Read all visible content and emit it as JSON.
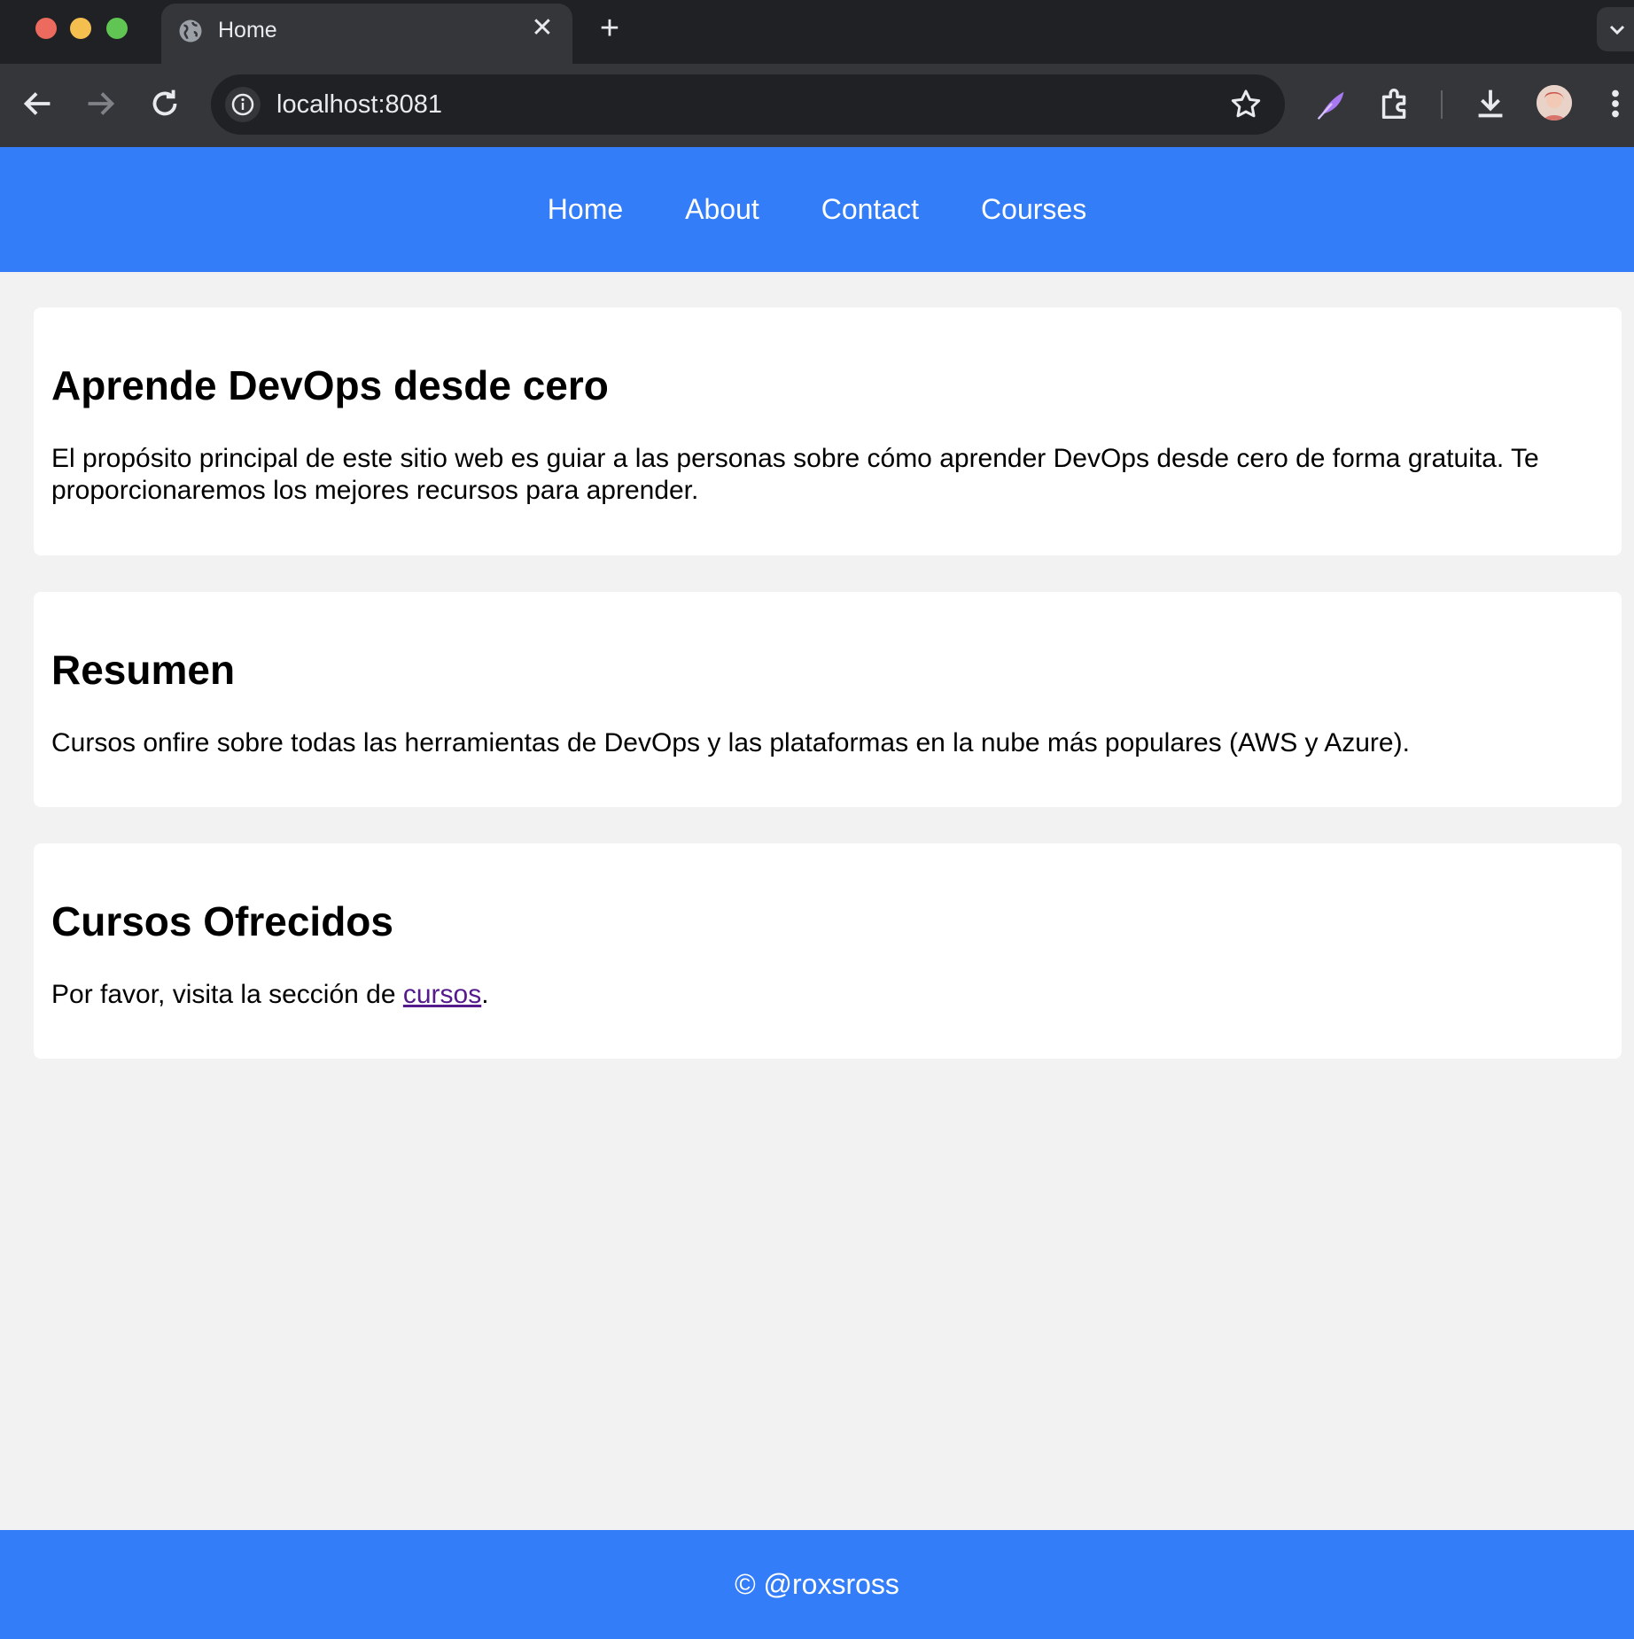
{
  "browser": {
    "tab_title": "Home",
    "url": "localhost:8081",
    "new_tab_glyph": "+",
    "close_glyph": "✕"
  },
  "nav": {
    "items": [
      "Home",
      "About",
      "Contact",
      "Courses"
    ]
  },
  "sections": [
    {
      "title": "Aprende DevOps desde cero",
      "text": "El propósito principal de este sitio web es guiar a las personas sobre cómo aprender DevOps desde cero de forma gratuita. Te proporcionaremos los mejores recursos para aprender."
    },
    {
      "title": "Resumen",
      "text": "Cursos onfire sobre todas las herramientas de DevOps y las plataformas en la nube más populares (AWS y Azure)."
    },
    {
      "title": "Cursos Ofrecidos",
      "text_before": "Por favor, visita la sección de ",
      "link": "cursos",
      "text_after": "."
    }
  ],
  "footer": {
    "text": "© @roxsross"
  },
  "colors": {
    "brand_blue": "#337ef8",
    "page_bg": "#f2f2f2",
    "visited_link": "#551a8b"
  },
  "icons": [
    "globe-icon",
    "back-arrow-icon",
    "forward-arrow-icon",
    "reload-icon",
    "site-info-icon",
    "bookmark-star-icon",
    "feather-extension-icon",
    "extensions-puzzle-icon",
    "download-icon",
    "profile-avatar",
    "kebab-menu-icon",
    "tab-search-chevron-icon"
  ]
}
